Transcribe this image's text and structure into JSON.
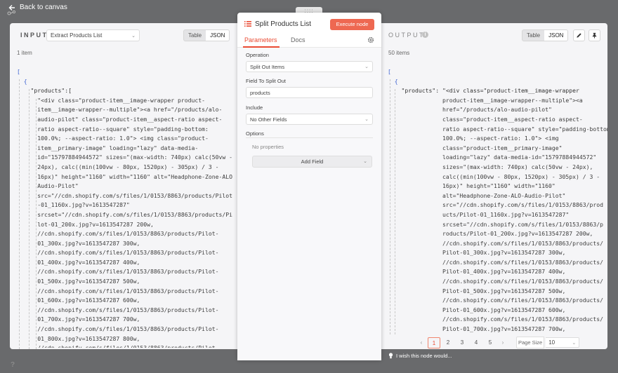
{
  "topbar": {
    "back_label": "Back to canvas"
  },
  "drag_handle": "::::",
  "input_panel": {
    "title": "INPUT",
    "node_select": "Extract Products List",
    "view_table": "Table",
    "view_json": "JSON",
    "count": "1 item",
    "json_lines": [
      "[",
      "  {",
      "    \"products\":[",
      "      \"<div class=\"product-item__image-wrapper product-",
      "      item__image-wrapper--multiple\"><a href=\"/products/alo-",
      "      audio-pilot\" class=\"product-item__aspect-ratio aspect-",
      "      ratio aspect-ratio--square\" style=\"padding-bottom:",
      "      100.0%; --aspect-ratio: 1.0\"> <img class=\"product-",
      "      item__primary-image\" loading=\"lazy\" data-media-",
      "      id=\"15797884944572\" sizes=\"(max-width: 740px) calc(50vw -",
      "      24px), calc((min(100vw - 80px, 1520px) - 305px) / 3 -",
      "      16px)\" height=\"1160\" width=\"1160\" alt=\"Headphone-Zone-ALO",
      "      Audio-Pilot\"",
      "      src=\"//cdn.shopify.com/s/files/1/0153/8863/products/Pilot",
      "      -01_1160x.jpg?v=1613547287\"",
      "      srcset=\"//cdn.shopify.com/s/files/1/0153/8863/products/Pi",
      "      lot-01_200x.jpg?v=1613547287 200w,",
      "      //cdn.shopify.com/s/files/1/0153/8863/products/Pilot-",
      "      01_300x.jpg?v=1613547287 300w,",
      "      //cdn.shopify.com/s/files/1/0153/8863/products/Pilot-",
      "      01_400x.jpg?v=1613547287 400w,",
      "      //cdn.shopify.com/s/files/1/0153/8863/products/Pilot-",
      "      01_500x.jpg?v=1613547287 500w,",
      "      //cdn.shopify.com/s/files/1/0153/8863/products/Pilot-",
      "      01_600x.jpg?v=1613547287 600w,",
      "      //cdn.shopify.com/s/files/1/0153/8863/products/Pilot-",
      "      01_700x.jpg?v=1613547287 700w,",
      "      //cdn.shopify.com/s/files/1/0153/8863/products/Pilot-",
      "      01_800x.jpg?v=1613547287 800w,",
      "      //cdn.shopify.com/s/files/1/0153/8863/products/Pilot-"
    ]
  },
  "center_panel": {
    "node_title": "Split Products List",
    "execute_label": "Execute node",
    "tab_parameters": "Parameters",
    "tab_docs": "Docs",
    "operation_label": "Operation",
    "operation_value": "Split Out Items",
    "field_label": "Field To Split Out",
    "field_value": "products",
    "include_label": "Include",
    "include_value": "No Other Fields",
    "options_label": "Options",
    "no_properties": "No properties",
    "add_field": "Add Field"
  },
  "output_panel": {
    "title": "OUTPUT",
    "view_table": "Table",
    "view_json": "JSON",
    "count": "50 items",
    "json_lines": [
      "[",
      "  {",
      "    \"products\": \"<div class=\"product-item__image-wrapper",
      "                product-item__image-wrapper--multiple\"><a",
      "                href=\"/products/alo-audio-pilot\"",
      "                class=\"product-item__aspect-ratio aspect-",
      "                ratio aspect-ratio--square\" style=\"padding-bottom:",
      "                100.0%; --aspect-ratio: 1.0\"> <img",
      "                class=\"product-item__primary-image\"",
      "                loading=\"lazy\" data-media-id=\"15797884944572\"",
      "                sizes=\"(max-width: 740px) calc(50vw - 24px),",
      "                calc((min(100vw - 80px, 1520px) - 305px) / 3 -",
      "                16px)\" height=\"1160\" width=\"1160\"",
      "                alt=\"Headphone-Zone-ALO-Audio-Pilot\"",
      "                src=\"//cdn.shopify.com/s/files/1/0153/8863/prod",
      "                ucts/Pilot-01_1160x.jpg?v=1613547287\"",
      "                srcset=\"//cdn.shopify.com/s/files/1/0153/8863/p",
      "                roducts/Pilot-01_200x.jpg?v=1613547287 200w,",
      "                //cdn.shopify.com/s/files/1/0153/8863/products/",
      "                Pilot-01_300x.jpg?v=1613547287 300w,",
      "                //cdn.shopify.com/s/files/1/0153/8863/products/",
      "                Pilot-01_400x.jpg?v=1613547287 400w,",
      "                //cdn.shopify.com/s/files/1/0153/8863/products/",
      "                Pilot-01_500x.jpg?v=1613547287 500w,",
      "                //cdn.shopify.com/s/files/1/0153/8863/products/",
      "                Pilot-01_600x.jpg?v=1613547287 600w,",
      "                //cdn.shopify.com/s/files/1/0153/8863/products/",
      "                Pilot-01_700x.jpg?v=1613547287 700w,"
    ],
    "pagination": {
      "pages": [
        "1",
        "2",
        "3",
        "4",
        "5"
      ],
      "active_page": "1",
      "prev": "‹",
      "next": "›",
      "page_size_label": "Page Size",
      "page_size_value": "10"
    }
  },
  "footer": {
    "wish_text": "I wish this node would...",
    "help": "?"
  },
  "colors": {
    "accent": "#ea4b33",
    "execute_button": "#ee6851",
    "backdrop": "#696a6c",
    "json_bracket": "#3a5fd0"
  },
  "icons": [
    "back-arrow-icon",
    "split-list-icon",
    "gear-icon",
    "info-icon",
    "pencil-icon",
    "pin-icon",
    "chevron-down-icon",
    "lightbulb-icon"
  ]
}
